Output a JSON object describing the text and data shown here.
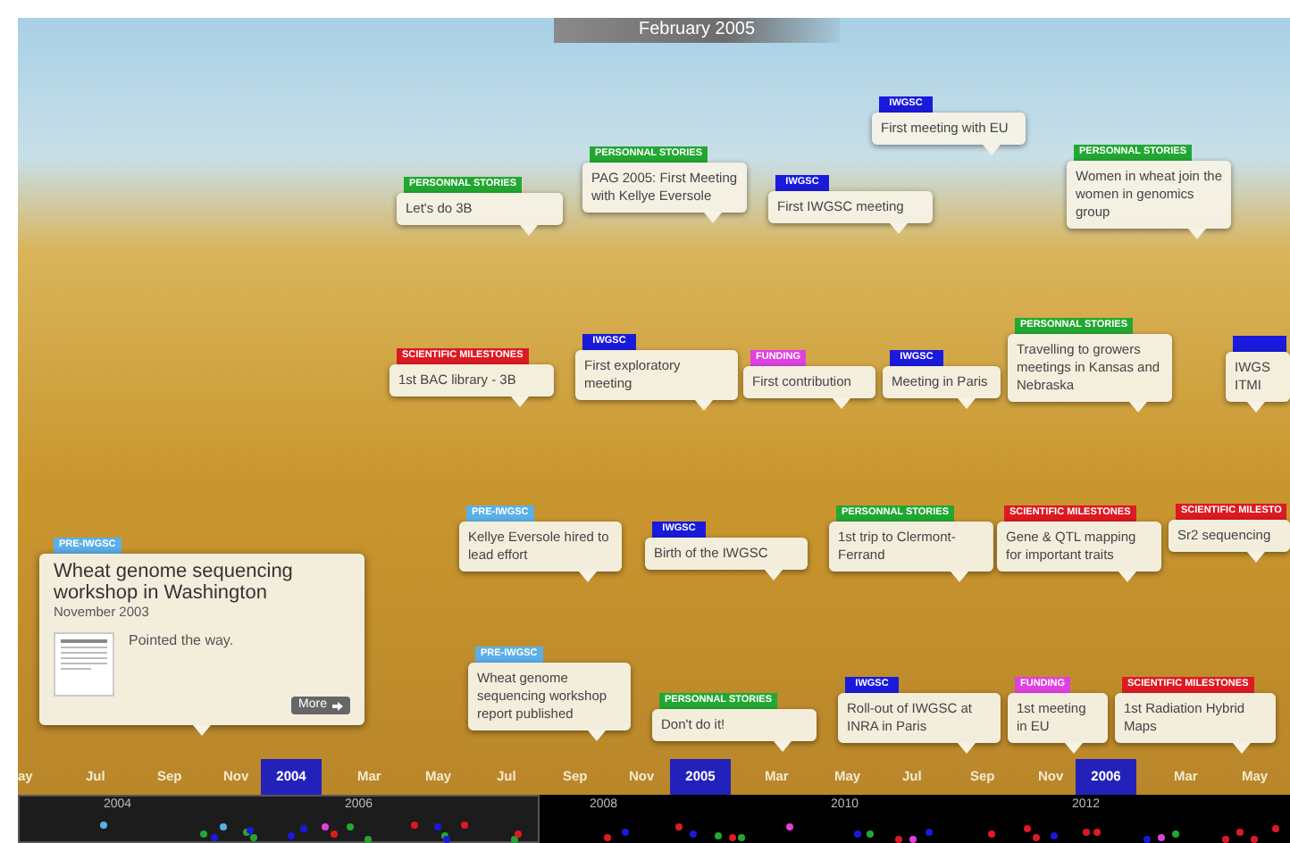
{
  "title": "February 2005",
  "events": [
    {
      "tag": "PERSONNAL STORIES",
      "color": "#22a832",
      "text": "Let's do 3B"
    },
    {
      "tag": "PERSONNAL STORIES",
      "color": "#22a832",
      "text": "PAG 2005: First Meeting with Kellye Eversole"
    },
    {
      "tag": "IWGSC",
      "color": "#1a1adc",
      "text": "First IWGSC meeting"
    },
    {
      "tag": "IWGSC",
      "color": "#1a1adc",
      "text": "First meeting with EU"
    },
    {
      "tag": "PERSONNAL STORIES",
      "color": "#22a832",
      "text": "Women in wheat join the women in genomics group"
    },
    {
      "tag": "SCIENTIFIC MILESTONES",
      "color": "#dd1a22",
      "text": "1st BAC library - 3B"
    },
    {
      "tag": "IWGSC",
      "color": "#1a1adc",
      "text": "First exploratory meeting"
    },
    {
      "tag": "FUNDING",
      "color": "#e040e0",
      "text": "First contribution"
    },
    {
      "tag": "IWGSC",
      "color": "#1a1adc",
      "text": "Meeting in Paris"
    },
    {
      "tag": "PERSONNAL STORIES",
      "color": "#22a832",
      "text": "Travelling to growers meetings in Kansas and Nebraska"
    },
    {
      "color": "#1a1adc",
      "text": "IWGS ITMI"
    },
    {
      "tag": "PRE-IWGSC",
      "color": "#5ab0e8",
      "text": "Kellye Eversole hired to lead effort"
    },
    {
      "tag": "IWGSC",
      "color": "#1a1adc",
      "text": "Birth of the IWGSC"
    },
    {
      "tag": "PERSONNAL STORIES",
      "color": "#22a832",
      "text": "1st trip to Clermont-Ferrand"
    },
    {
      "tag": "SCIENTIFIC MILESTONES",
      "color": "#dd1a22",
      "text": "Gene & QTL mapping for important traits"
    },
    {
      "tag": "SCIENTIFIC MILESTO",
      "color": "#dd1a22",
      "text": "Sr2 sequencing"
    },
    {
      "tag": "PRE-IWGSC",
      "color": "#5ab0e8",
      "text": "Wheat genome sequencing workshop report published"
    },
    {
      "tag": "PERSONNAL STORIES",
      "color": "#22a832",
      "text": "Don't do it!"
    },
    {
      "tag": "IWGSC",
      "color": "#1a1adc",
      "text": "Roll-out of IWGSC at INRA in Paris"
    },
    {
      "tag": "FUNDING",
      "color": "#e040e0",
      "text": "1st meeting in EU"
    },
    {
      "tag": "SCIENTIFIC MILESTONES",
      "color": "#dd1a22",
      "text": "1st Radiation Hybrid Maps"
    }
  ],
  "detail": {
    "tag": "PRE-IWGSC",
    "color": "#5ab0e8",
    "title": "Wheat genome sequencing workshop in Washington",
    "date": "November 2003",
    "description": "Pointed the way.",
    "more": "More"
  },
  "axis": [
    {
      "label": "ay",
      "kind": "month"
    },
    {
      "label": "Jul",
      "kind": "month"
    },
    {
      "label": "Sep",
      "kind": "month"
    },
    {
      "label": "Nov",
      "kind": "month"
    },
    {
      "label": "2004",
      "kind": "year"
    },
    {
      "label": "Mar",
      "kind": "month"
    },
    {
      "label": "May",
      "kind": "month"
    },
    {
      "label": "Jul",
      "kind": "month"
    },
    {
      "label": "Sep",
      "kind": "month"
    },
    {
      "label": "Nov",
      "kind": "month"
    },
    {
      "label": "2005",
      "kind": "year"
    },
    {
      "label": "Mar",
      "kind": "month"
    },
    {
      "label": "May",
      "kind": "month"
    },
    {
      "label": "Jul",
      "kind": "month"
    },
    {
      "label": "Sep",
      "kind": "month"
    },
    {
      "label": "Nov",
      "kind": "month"
    },
    {
      "label": "2006",
      "kind": "year"
    },
    {
      "label": "Mar",
      "kind": "month"
    },
    {
      "label": "May",
      "kind": "month"
    }
  ],
  "overview_years": [
    "2004",
    "2006",
    "2008",
    "2010",
    "2012"
  ]
}
